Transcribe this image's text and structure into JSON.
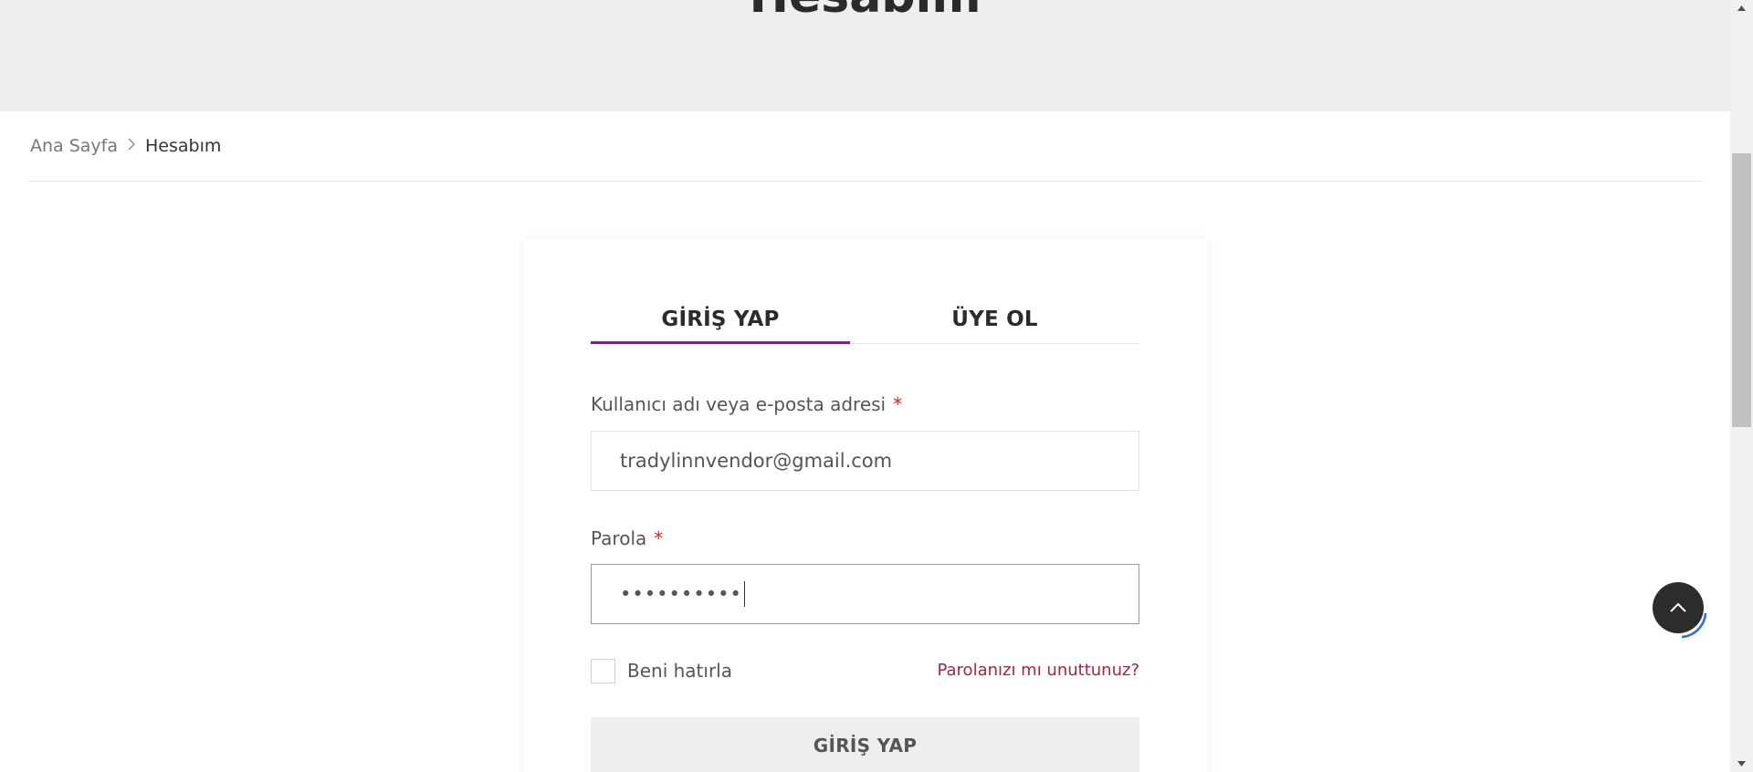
{
  "hero": {
    "title": "Hesabım"
  },
  "breadcrumb": {
    "home": "Ana Sayfa",
    "separator": ">",
    "current": "Hesabım"
  },
  "tabs": {
    "login": "GİRİŞ YAP",
    "register": "ÜYE OL",
    "active": "login"
  },
  "form": {
    "username_label": "Kullanıcı adı veya e-posta adresi",
    "username_value": "tradylinnvendor@gmail.com",
    "password_label": "Parola",
    "password_masked": "••••••••••",
    "required_mark": "*",
    "remember_label": "Beni hatırla",
    "remember_checked": false,
    "forgot_link": "Parolanızı mı unuttunuz?",
    "submit_label": "GİRİŞ YAP"
  },
  "icons": {
    "back_to_top": "chevron-up-icon",
    "breadcrumb_separator": "chevron-right-icon"
  },
  "colors": {
    "accent": "#7a1e91",
    "required": "#e02020",
    "link": "#a02a3c",
    "hero_bg": "#eeeeee",
    "to_top_bg": "#2c2c2c",
    "to_top_ring": "#2d6fe0"
  }
}
